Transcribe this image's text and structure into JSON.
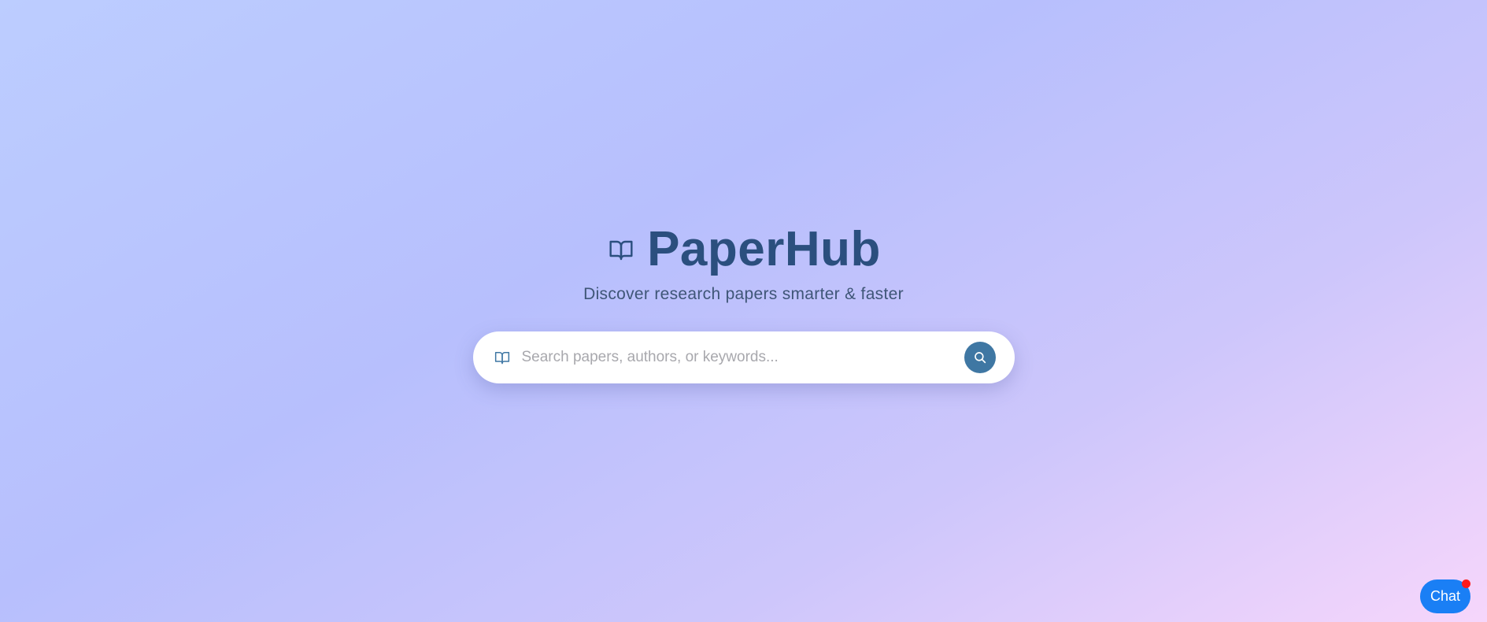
{
  "brand": {
    "title": "PaperHub",
    "tagline": "Discover research papers smarter & faster",
    "icon": "book-open-icon"
  },
  "search": {
    "placeholder": "Search papers, authors, or keywords...",
    "value": "",
    "leading_icon": "book-open-icon",
    "button_icon": "search-icon"
  },
  "chat": {
    "label": "Chat",
    "has_notification": true
  },
  "colors": {
    "brand_text": "#2b4f7e",
    "accent": "#3f77a3",
    "chat_button": "#1a7ff5",
    "notification": "#ff1a1a"
  }
}
